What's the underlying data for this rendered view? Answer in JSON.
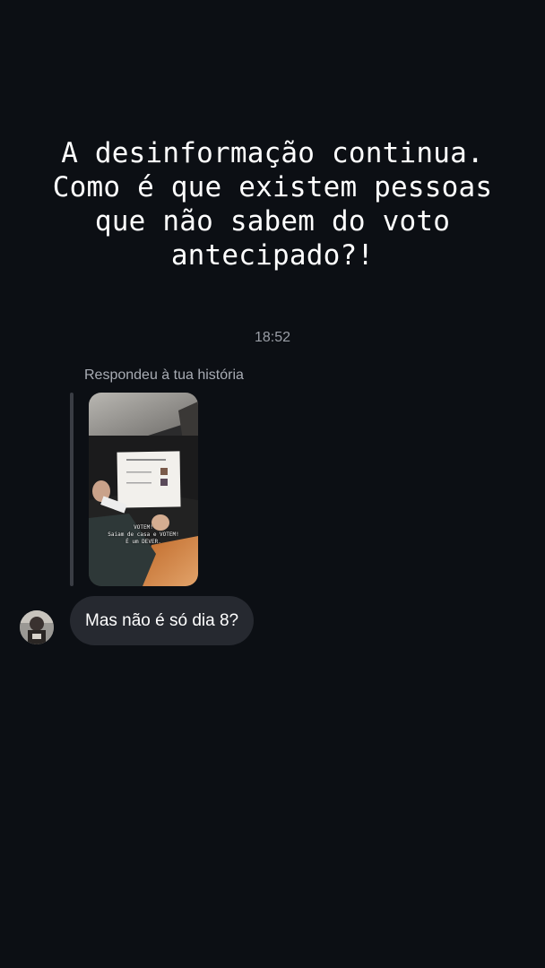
{
  "caption": {
    "lines": [
      "A desinformação continua.",
      "Como é que existem pessoas",
      "que não sabem do voto",
      "antecipado?!"
    ]
  },
  "chat": {
    "timestamp": "18:52",
    "reply_label": "Respondeu à tua história",
    "story": {
      "overlay_lines": [
        "VOTEM!",
        "Saiam de casa e VOTEM!",
        "É um DEVER."
      ]
    },
    "message": "Mas não é só dia 8?"
  },
  "colors": {
    "background": "#0c0f14",
    "bubble": "#262930",
    "muted_text": "#9a9ea6"
  }
}
